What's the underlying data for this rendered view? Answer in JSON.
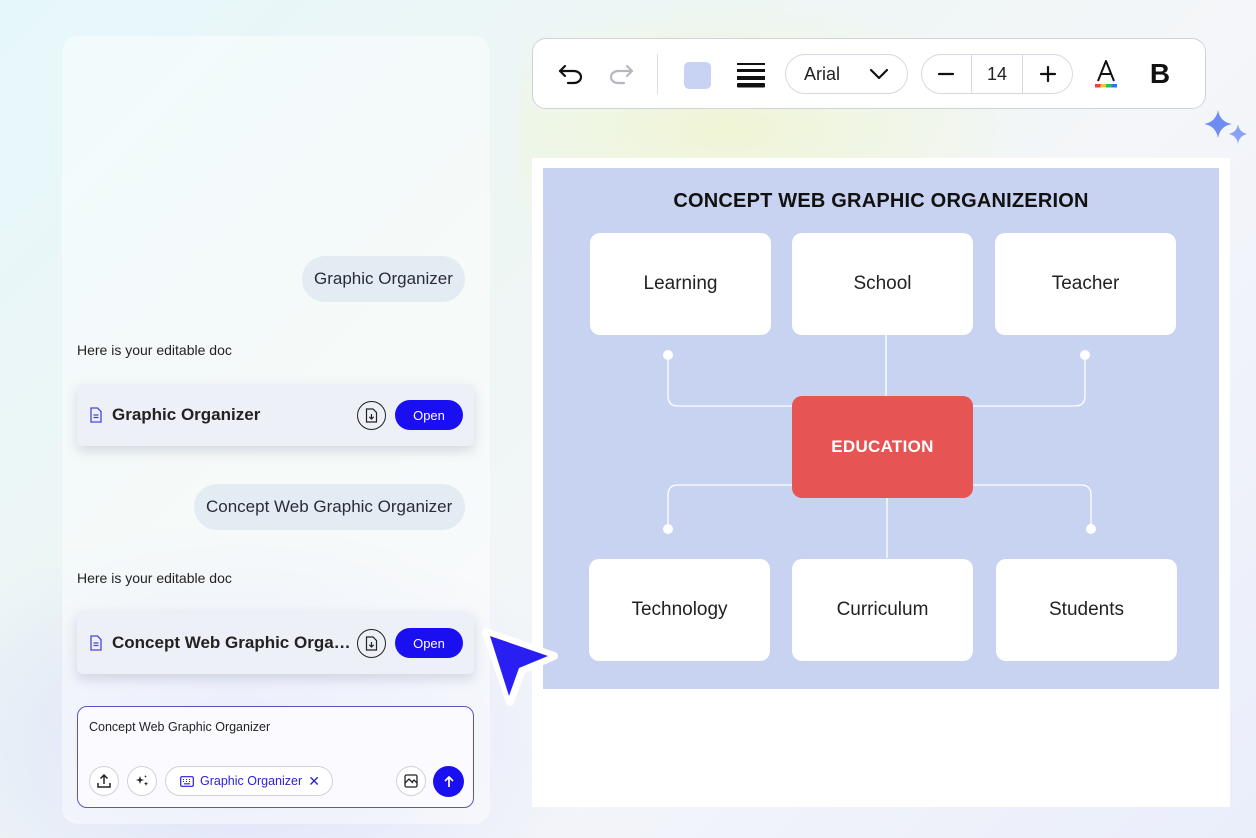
{
  "chat": {
    "messages": [
      {
        "role": "user",
        "text": "Graphic Organizer"
      },
      {
        "role": "assistant",
        "text": "Here is your editable doc",
        "doc_title": "Graphic Organizer",
        "open_label": "Open"
      },
      {
        "role": "user",
        "text": "Concept Web Graphic Organizer"
      },
      {
        "role": "assistant",
        "text": "Here is your editable doc",
        "doc_title": "Concept Web Graphic Organizer",
        "open_label": "Open"
      }
    ],
    "composer": {
      "text": "Concept Web Graphic Organizer",
      "chip_label": "Graphic Organizer",
      "chip_remove": "✕"
    }
  },
  "toolbar": {
    "fill_color": "#c8d3f4",
    "font": "Arial",
    "font_size": "14",
    "decrease_label": "−",
    "increase_label": "+",
    "bold_label": "B",
    "text_color_label": "A"
  },
  "diagram": {
    "title": "CONCEPT WEB GRAPHIC ORGANIZERION",
    "center": "EDUCATION",
    "top_nodes": [
      "Learning",
      "School",
      "Teacher"
    ],
    "bottom_nodes": [
      "Technology",
      "Curriculum",
      "Students"
    ],
    "colors": {
      "background": "#c8d3f2",
      "center": "#e65454",
      "node": "#ffffff",
      "accent": "#1a0ff0"
    }
  }
}
